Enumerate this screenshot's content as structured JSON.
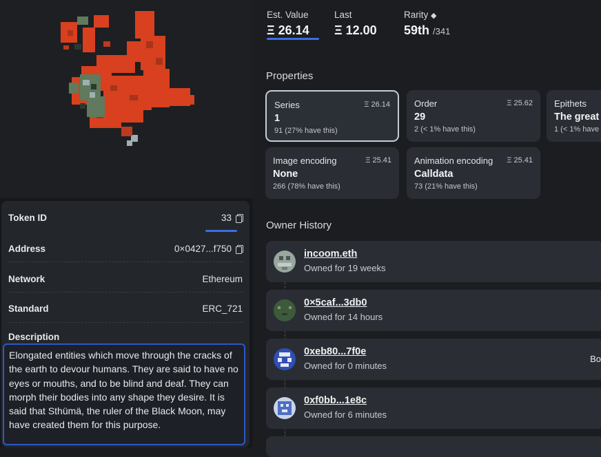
{
  "token": {
    "fields": [
      {
        "key": "Token ID",
        "value": "33"
      },
      {
        "key": "Address",
        "value": "0×0427...f750"
      },
      {
        "key": "Network",
        "value": "Ethereum"
      },
      {
        "key": "Standard",
        "value": "ERC_721"
      }
    ],
    "description_label": "Description",
    "description": "Elongated entities which move through the cracks of the earth to devour humans. They are said to have no eyes or mouths, and to be blind and deaf. They can morph their bodies into any shape they desire. It is said that Sthümä, the ruler of the Black Moon, may have created them for this purpose."
  },
  "stats": {
    "est_value_label": "Est. Value",
    "est_value": "Ξ 26.14",
    "last_label": "Last",
    "last": "Ξ 12.00",
    "rarity_label": "Rarity",
    "rarity_icon": "diamond-icon",
    "rarity": "59th",
    "rarity_total": "/341"
  },
  "properties": {
    "title": "Properties",
    "items": [
      {
        "key": "Series",
        "price": "Ξ 26.14",
        "value": "1",
        "count": "91 (27% have this)",
        "selected": true
      },
      {
        "key": "Order",
        "price": "Ξ 25.62",
        "value": "29",
        "count": "2 (< 1% have this)"
      },
      {
        "key": "Epithets",
        "price": "",
        "value": "The great",
        "count": "1 (< 1% have"
      },
      {
        "key": "Image encoding",
        "price": "Ξ 25.41",
        "value": "None",
        "count": "266 (78% have this)"
      },
      {
        "key": "Animation encoding",
        "price": "Ξ 25.41",
        "value": "Calldata",
        "count": "73 (21% have this)"
      }
    ]
  },
  "owner_history": {
    "title": "Owner History",
    "owners": [
      {
        "name": "incoom.eth",
        "duration": "Owned for 19 weeks",
        "extra": "",
        "avatar_color": "#9aa6a0"
      },
      {
        "name": "0×5caf...3db0",
        "duration": "Owned for 14 hours",
        "extra": "",
        "avatar_color": "#3e5a3c"
      },
      {
        "name": "0xeb80...7f0e",
        "duration": "Owned for 0 minutes",
        "extra": "Bo",
        "avatar_color": "#2f4fb3"
      },
      {
        "name": "0xf0bb...1e8c",
        "duration": "Owned for 6 minutes",
        "extra": "",
        "avatar_color": "#4d6fc4"
      }
    ]
  },
  "colors": {
    "accent": "#3b6fe6",
    "selected_border": "#c9ced6",
    "art_red": "#d8401f",
    "art_green": "#5f7a5c"
  }
}
